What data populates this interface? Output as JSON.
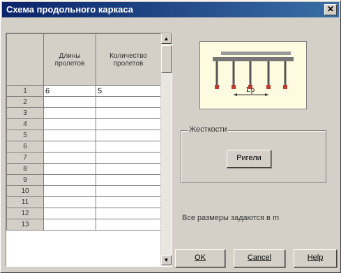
{
  "window": {
    "title": "Схема продольного каркаса",
    "close_glyph": "✕"
  },
  "grid": {
    "columns": [
      "Длины пролетов",
      "Количество пролетов"
    ],
    "rows": [
      {
        "num": "1",
        "c1": "6",
        "c2": "5"
      },
      {
        "num": "2",
        "c1": "",
        "c2": ""
      },
      {
        "num": "3",
        "c1": "",
        "c2": ""
      },
      {
        "num": "4",
        "c1": "",
        "c2": ""
      },
      {
        "num": "5",
        "c1": "",
        "c2": ""
      },
      {
        "num": "6",
        "c1": "",
        "c2": ""
      },
      {
        "num": "7",
        "c1": "",
        "c2": ""
      },
      {
        "num": "8",
        "c1": "",
        "c2": ""
      },
      {
        "num": "9",
        "c1": "",
        "c2": ""
      },
      {
        "num": "10",
        "c1": "",
        "c2": ""
      },
      {
        "num": "11",
        "c1": "",
        "c2": ""
      },
      {
        "num": "12",
        "c1": "",
        "c2": ""
      },
      {
        "num": "13",
        "c1": "",
        "c2": ""
      }
    ]
  },
  "schematic": {
    "dimension_label": "Lp",
    "column_color": "#c0392b"
  },
  "stiffness": {
    "legend": "Жесткости",
    "button": "Ригели"
  },
  "hint": "Все размеры задаются в m",
  "buttons": {
    "ok": "OK",
    "cancel": "Cancel",
    "help": "Help"
  }
}
